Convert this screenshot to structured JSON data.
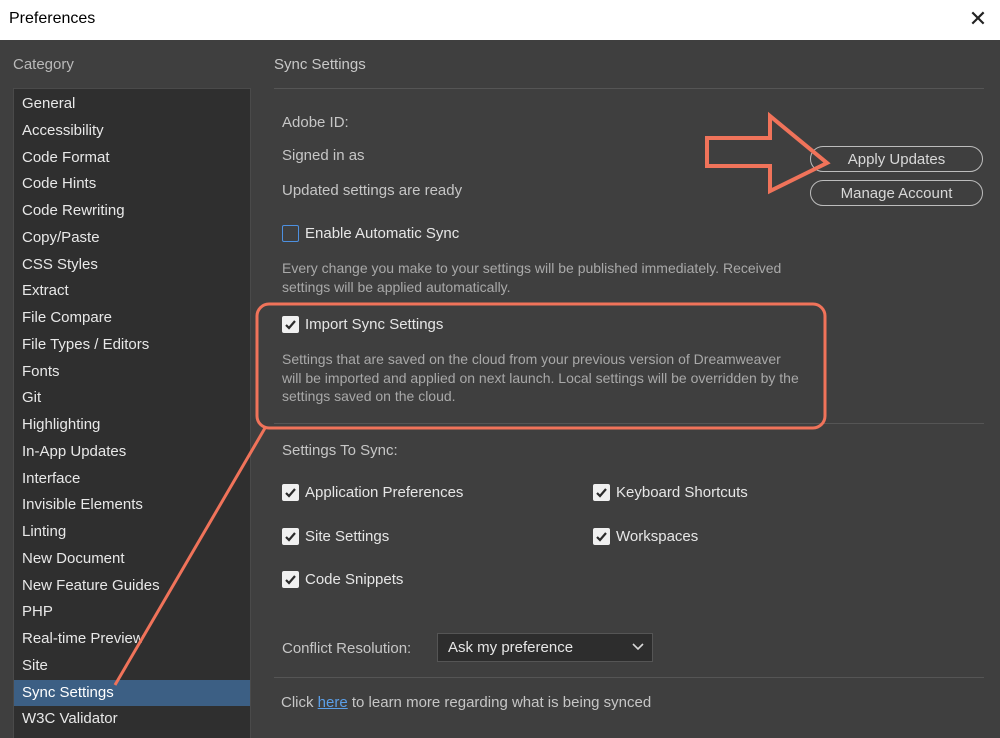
{
  "window": {
    "title": "Preferences",
    "close_glyph": "✕"
  },
  "sidebar": {
    "header": "Category",
    "items": [
      {
        "label": "General"
      },
      {
        "label": "Accessibility"
      },
      {
        "label": "Code Format"
      },
      {
        "label": "Code Hints"
      },
      {
        "label": "Code Rewriting"
      },
      {
        "label": "Copy/Paste"
      },
      {
        "label": "CSS Styles"
      },
      {
        "label": "Extract"
      },
      {
        "label": "File Compare"
      },
      {
        "label": "File Types / Editors"
      },
      {
        "label": "Fonts"
      },
      {
        "label": "Git"
      },
      {
        "label": "Highlighting"
      },
      {
        "label": "In-App Updates"
      },
      {
        "label": "Interface"
      },
      {
        "label": "Invisible Elements"
      },
      {
        "label": "Linting"
      },
      {
        "label": "New Document"
      },
      {
        "label": "New Feature Guides"
      },
      {
        "label": "PHP"
      },
      {
        "label": "Real-time Preview"
      },
      {
        "label": "Site"
      },
      {
        "label": "Sync Settings",
        "selected": true
      },
      {
        "label": "W3C Validator"
      }
    ]
  },
  "panel": {
    "title": "Sync Settings",
    "adobe_id_label": "Adobe ID:",
    "signed_in_label": "Signed in as",
    "status": "Updated settings are ready",
    "apply_updates_label": "Apply Updates",
    "manage_account_label": "Manage Account",
    "auto_sync": {
      "label": "Enable Automatic Sync",
      "checked": false,
      "description": "Every change you make to your settings will be published immediately. Received settings will be applied automatically."
    },
    "import_sync": {
      "label": "Import Sync Settings",
      "checked": true,
      "description": "Settings that are saved on the cloud from your previous version of Dreamweaver will be imported and applied on next launch. Local settings will be overridden by the settings saved on the cloud."
    },
    "settings_to_sync_label": "Settings To Sync:",
    "sync_options": {
      "app_prefs": {
        "label": "Application Preferences",
        "checked": true
      },
      "keyboard": {
        "label": "Keyboard Shortcuts",
        "checked": true
      },
      "site": {
        "label": "Site Settings",
        "checked": true
      },
      "workspaces": {
        "label": "Workspaces",
        "checked": true
      },
      "snippets": {
        "label": "Code Snippets",
        "checked": true
      }
    },
    "conflict_label": "Conflict Resolution:",
    "conflict_value": "Ask my preference",
    "footer": {
      "prefix": "Click ",
      "link": "here",
      "suffix": " to learn more regarding what is being synced"
    }
  },
  "annotation": {
    "color": "#f0735a"
  }
}
